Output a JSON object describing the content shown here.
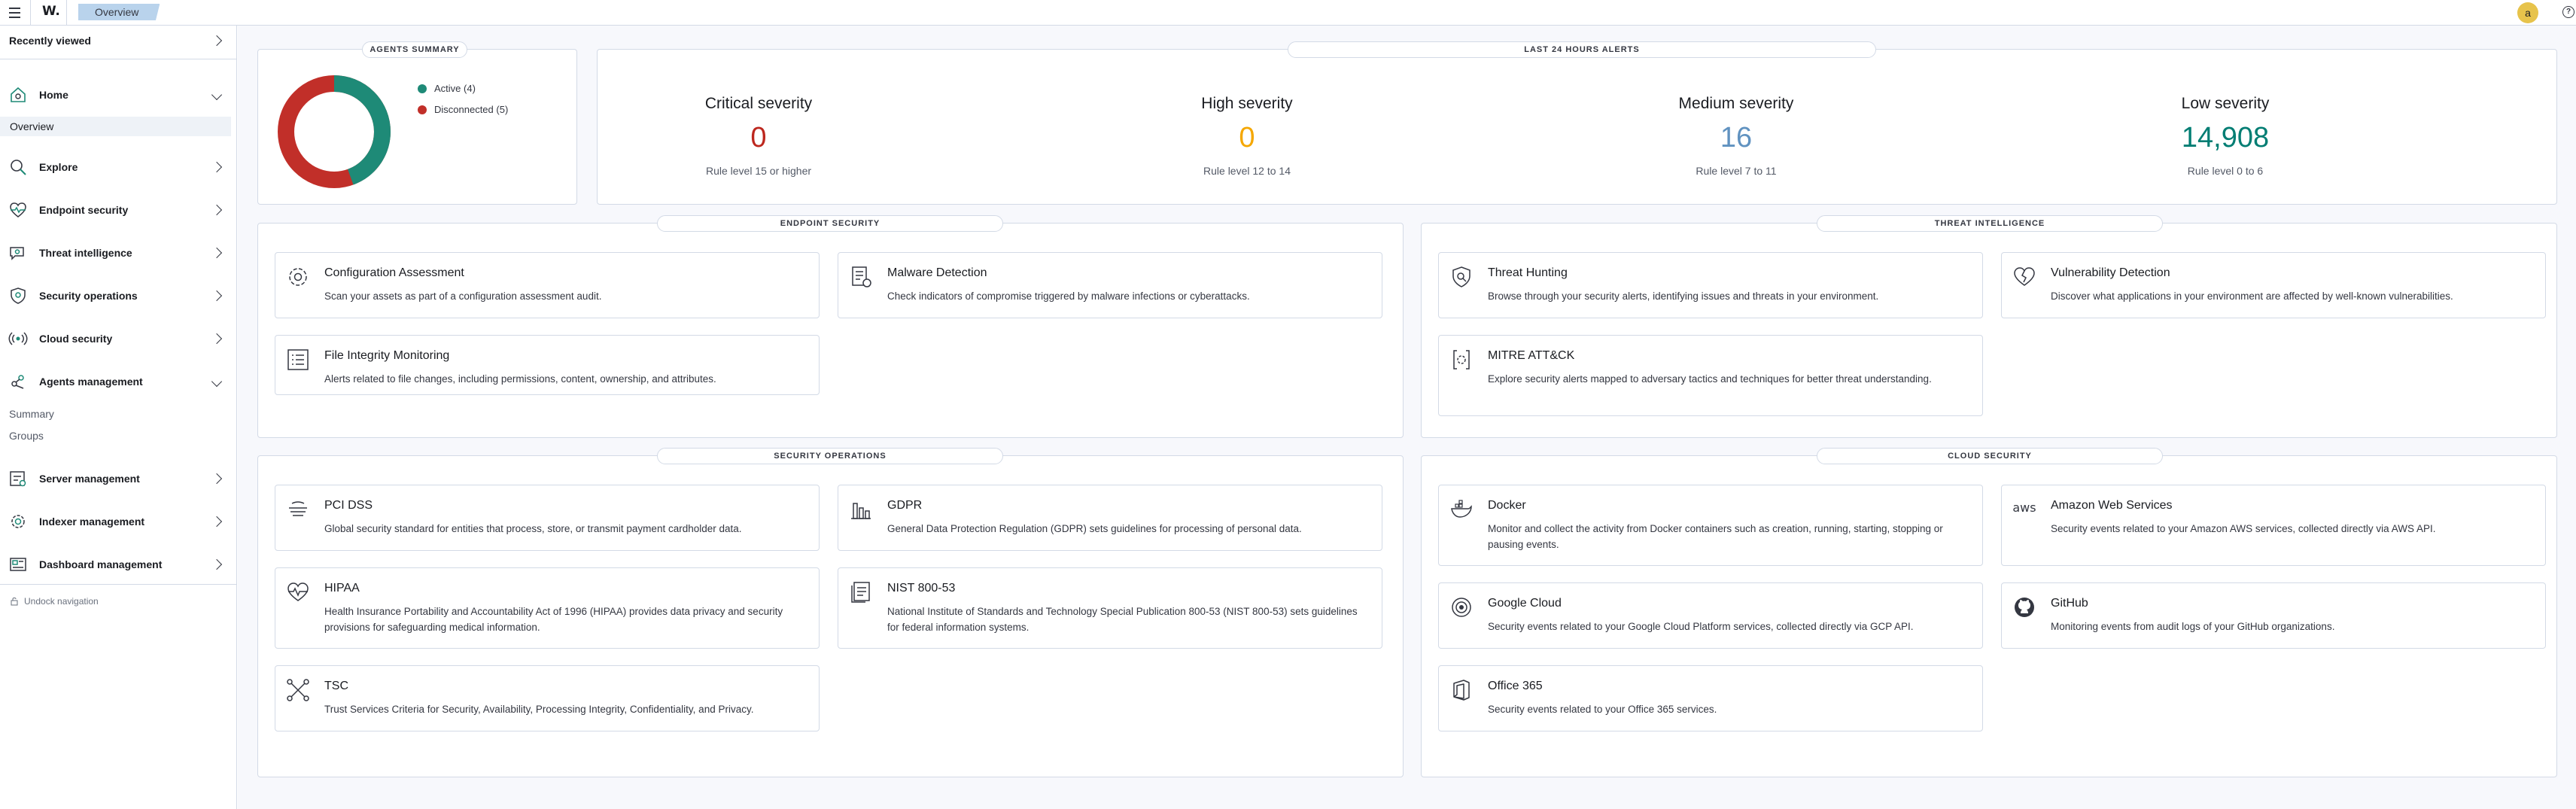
{
  "topbar": {
    "logo": "W.",
    "breadcrumb": "Overview",
    "avatar_letter": "a"
  },
  "sidebar": {
    "recently_viewed": "Recently viewed",
    "home": "Home",
    "home_sub": [
      "Overview"
    ],
    "explore": "Explore",
    "endpoint_security": "Endpoint security",
    "threat_intelligence": "Threat intelligence",
    "security_operations": "Security operations",
    "cloud_security": "Cloud security",
    "agents_management": "Agents management",
    "agents_sub": [
      "Summary",
      "Groups"
    ],
    "server_management": "Server management",
    "indexer_management": "Indexer management",
    "dashboard_management": "Dashboard management",
    "undock": "Undock navigation"
  },
  "agents_summary": {
    "title": "AGENTS SUMMARY",
    "active_label": "Active (4)",
    "disconnected_label": "Disconnected (5)",
    "active_count": 4,
    "disconnected_count": 5,
    "active_color": "#1e8a77",
    "disconnected_color": "#c12f29"
  },
  "alerts": {
    "title": "LAST 24 HOURS ALERTS",
    "items": [
      {
        "name": "Critical severity",
        "value": "0",
        "rule": "Rule level 15 or higher",
        "color": "#bd271e"
      },
      {
        "name": "High severity",
        "value": "0",
        "rule": "Rule level 12 to 14",
        "color": "#f5a700"
      },
      {
        "name": "Medium severity",
        "value": "16",
        "rule": "Rule level 7 to 11",
        "color": "#6092c0"
      },
      {
        "name": "Low severity",
        "value": "14,908",
        "rule": "Rule level 0 to 6",
        "color": "#017d73"
      }
    ]
  },
  "endpoint_security": {
    "title": "ENDPOINT SECURITY",
    "cards": [
      {
        "title": "Configuration Assessment",
        "desc": "Scan your assets as part of a configuration assessment audit."
      },
      {
        "title": "Malware Detection",
        "desc": "Check indicators of compromise triggered by malware infections or cyberattacks."
      },
      {
        "title": "File Integrity Monitoring",
        "desc": "Alerts related to file changes, including permissions, content, ownership, and attributes."
      }
    ]
  },
  "threat_intelligence": {
    "title": "THREAT INTELLIGENCE",
    "cards": [
      {
        "title": "Threat Hunting",
        "desc": "Browse through your security alerts, identifying issues and threats in your environment."
      },
      {
        "title": "Vulnerability Detection",
        "desc": "Discover what applications in your environment are affected by well-known vulnerabilities."
      },
      {
        "title": "MITRE ATT&CK",
        "desc": "Explore security alerts mapped to adversary tactics and techniques for better threat understanding."
      }
    ]
  },
  "security_operations": {
    "title": "SECURITY OPERATIONS",
    "cards": [
      {
        "title": "PCI DSS",
        "desc": "Global security standard for entities that process, store, or transmit payment cardholder data."
      },
      {
        "title": "GDPR",
        "desc": "General Data Protection Regulation (GDPR) sets guidelines for processing of personal data."
      },
      {
        "title": "HIPAA",
        "desc": "Health Insurance Portability and Accountability Act of 1996 (HIPAA) provides data privacy and security provisions for safeguarding medical information."
      },
      {
        "title": "NIST 800-53",
        "desc": "National Institute of Standards and Technology Special Publication 800-53 (NIST 800-53) sets guidelines for federal information systems."
      },
      {
        "title": "TSC",
        "desc": "Trust Services Criteria for Security, Availability, Processing Integrity, Confidentiality, and Privacy."
      }
    ]
  },
  "cloud_security": {
    "title": "CLOUD SECURITY",
    "cards": [
      {
        "title": "Docker",
        "desc": "Monitor and collect the activity from Docker containers such as creation, running, starting, stopping or pausing events."
      },
      {
        "title": "Amazon Web Services",
        "desc": "Security events related to your Amazon AWS services, collected directly via AWS API."
      },
      {
        "title": "Google Cloud",
        "desc": "Security events related to your Google Cloud Platform services, collected directly via GCP API."
      },
      {
        "title": "GitHub",
        "desc": "Monitoring events from audit logs of your GitHub organizations."
      },
      {
        "title": "Office 365",
        "desc": "Security events related to your Office 365 services."
      }
    ]
  },
  "icons": {
    "aws_text": "aws"
  }
}
